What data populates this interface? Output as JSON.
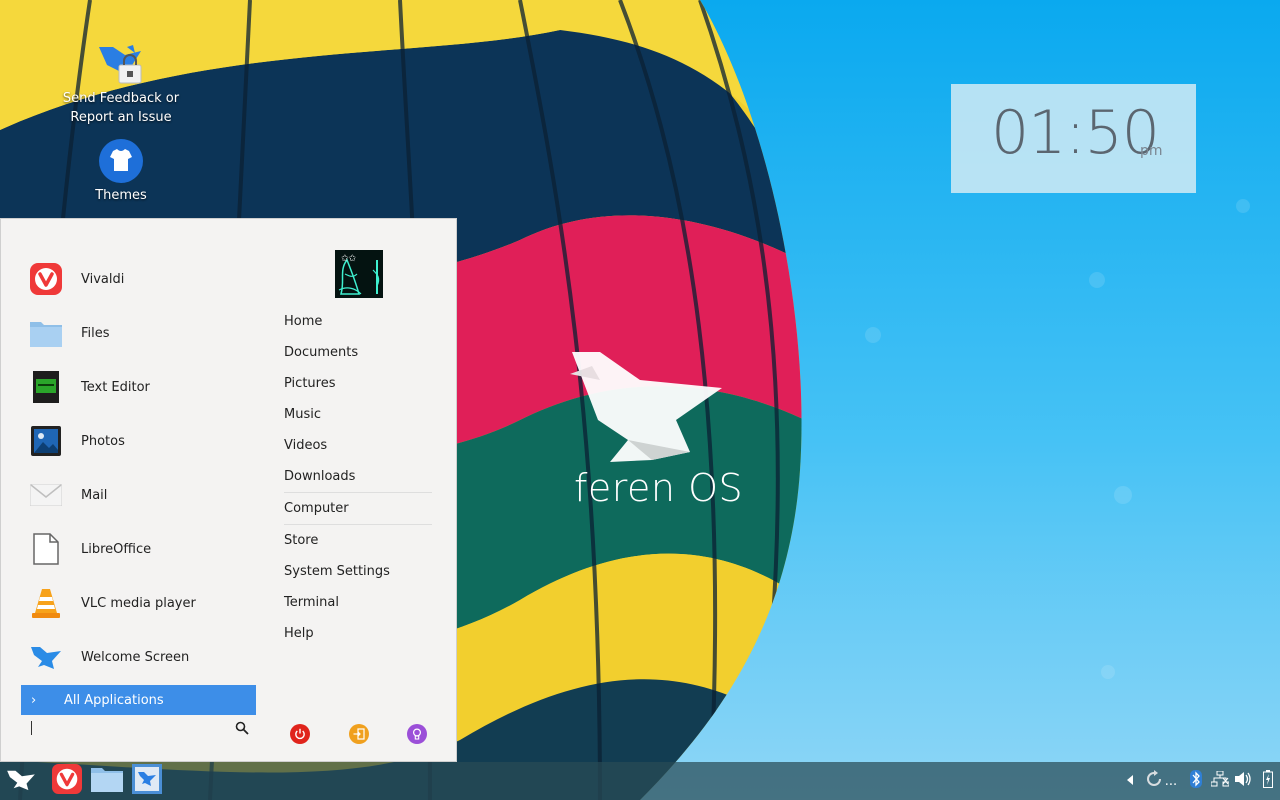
{
  "desktop": {
    "icons": [
      {
        "label_line1": "Send Feedback or",
        "label_line2": "Report an Issue",
        "icon": "feedback-bird-lock-icon"
      },
      {
        "label": "Themes",
        "icon": "tshirt-icon"
      }
    ],
    "brand": "feren OS"
  },
  "clock": {
    "time": "01:50",
    "ampm": "pm"
  },
  "menu": {
    "favorites": [
      {
        "label": "Vivaldi",
        "icon": "vivaldi-icon"
      },
      {
        "label": "Files",
        "icon": "folder-icon"
      },
      {
        "label": "Text Editor",
        "icon": "text-editor-icon"
      },
      {
        "label": "Photos",
        "icon": "photos-icon"
      },
      {
        "label": "Mail",
        "icon": "mail-icon"
      },
      {
        "label": "LibreOffice",
        "icon": "document-icon"
      },
      {
        "label": "VLC media player",
        "icon": "vlc-cone-icon"
      },
      {
        "label": "Welcome Screen",
        "icon": "feren-bird-icon"
      }
    ],
    "all_applications": "All Applications",
    "search": {
      "value": "",
      "placeholder": ""
    },
    "places": [
      "Home",
      "Documents",
      "Pictures",
      "Music",
      "Videos",
      "Downloads",
      "Computer",
      "Store",
      "System Settings",
      "Terminal",
      "Help"
    ],
    "power_buttons": [
      {
        "icon": "power-icon",
        "color": "#e0241c"
      },
      {
        "icon": "logout-icon",
        "color": "#f0a01e"
      },
      {
        "icon": "lightbulb-icon",
        "color": "#9b4fd8"
      }
    ]
  },
  "taskbar": {
    "launcher_icon": "feren-bird-icon",
    "pinned": [
      "vivaldi-icon",
      "folder-icon",
      "welcome-screen-icon"
    ],
    "tray": [
      "expand-arrow-icon",
      "updates-icon",
      "bluetooth-icon",
      "network-icon",
      "volume-icon",
      "battery-icon"
    ],
    "tray_overflow": "..."
  },
  "colors": {
    "accent": "#3d8ee8",
    "menu_bg": "#f4f3f2",
    "sky": "#0aa9ef"
  }
}
